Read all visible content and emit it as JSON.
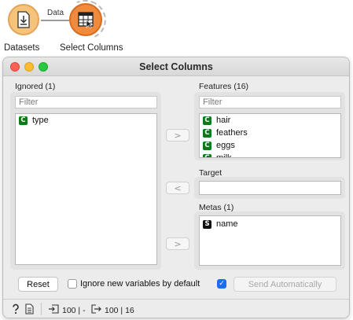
{
  "workflow": {
    "nodes": [
      {
        "label": "Datasets",
        "icon": "download-document-icon"
      },
      {
        "label": "Select Columns",
        "icon": "select-columns-icon"
      }
    ],
    "link_label": "Data"
  },
  "window": {
    "title": "Select Columns"
  },
  "ignored": {
    "title": "Ignored (1)",
    "filter_placeholder": "Filter",
    "items": [
      {
        "type": "C",
        "name": "type"
      }
    ]
  },
  "features": {
    "title": "Features (16)",
    "filter_placeholder": "Filter",
    "items": [
      {
        "type": "C",
        "name": "hair"
      },
      {
        "type": "C",
        "name": "feathers"
      },
      {
        "type": "C",
        "name": "eggs"
      },
      {
        "type": "C",
        "name": "milk"
      }
    ]
  },
  "target": {
    "title": "Target",
    "value": ""
  },
  "metas": {
    "title": "Metas (1)",
    "items": [
      {
        "type": "S",
        "name": "name"
      }
    ]
  },
  "buttons": {
    "move_to_features": ">",
    "move_to_target": "<",
    "move_to_metas": ">",
    "reset": "Reset",
    "send": "Send Automatically"
  },
  "options": {
    "ignore_new_label": "Ignore new variables by default",
    "ignore_new_checked": false,
    "send_auto_checked": true
  },
  "status": {
    "input_summary": "100 | -",
    "output_summary": "100 | 16"
  },
  "colors": {
    "accent": "#1a6cf0",
    "continuous_badge": "#0d7a1a",
    "string_badge": "#111111"
  }
}
